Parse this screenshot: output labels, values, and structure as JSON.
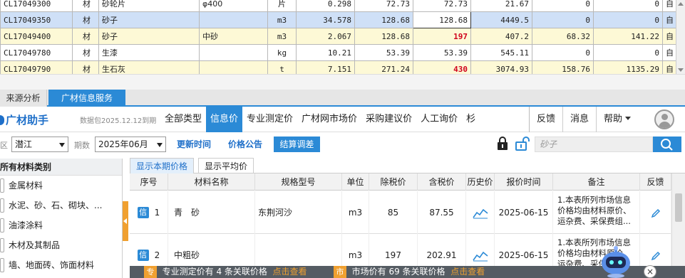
{
  "top_grid": {
    "rows": [
      {
        "code": "CL17049300",
        "type": "材",
        "name": "砂轮片",
        "spec": "φ400",
        "unit": "片",
        "qty": "0.298",
        "p1": "72.73",
        "p2": "72.73",
        "p3": "21.67",
        "p4": "0",
        "p5": "0",
        "src": "自",
        "style": "plain",
        "p2_red": false
      },
      {
        "code": "CL17049350",
        "type": "材",
        "name": "砂子",
        "spec": "",
        "unit": "m3",
        "qty": "34.578",
        "p1": "128.68",
        "p2": "128.68",
        "p3": "4449.5",
        "p4": "0",
        "p5": "0",
        "src": "自",
        "style": "selected",
        "p2_red": false
      },
      {
        "code": "CL17049400",
        "type": "材",
        "name": "砂子",
        "spec": "中砂",
        "unit": "m3",
        "qty": "2.067",
        "p1": "128.68",
        "p2": "197",
        "p3": "407.2",
        "p4": "68.32",
        "p5": "141.22",
        "src": "自",
        "style": "yellow",
        "p2_red": true
      },
      {
        "code": "CL17049780",
        "type": "材",
        "name": "生漆",
        "spec": "",
        "unit": "kg",
        "qty": "10.21",
        "p1": "53.39",
        "p2": "53.39",
        "p3": "545.11",
        "p4": "0",
        "p5": "0",
        "src": "自",
        "style": "plain",
        "p2_red": false
      },
      {
        "code": "CL17049790",
        "type": "材",
        "name": "生石灰",
        "spec": "",
        "unit": "t",
        "qty": "7.151",
        "p1": "271.24",
        "p2": "430",
        "p3": "3074.93",
        "p4": "158.76",
        "p5": "1135.29",
        "src": "自",
        "style": "yellow",
        "p2_red": true
      }
    ]
  },
  "tabs": {
    "t1": "来源分析",
    "t2": "广材信息服务"
  },
  "header": {
    "logo_text": "广材助手",
    "db_date": "数据包2025.12.12到期",
    "nav": [
      "全部类型",
      "信息价",
      "专业测定价",
      "广材网市场价",
      "采购建议价",
      "人工询价",
      "杉"
    ],
    "active_nav_index": 1,
    "right": {
      "feedback": "反馈",
      "message": "消息",
      "help": "帮助"
    }
  },
  "filter": {
    "region_label": "区",
    "region_value": "潜江",
    "period_label": "期数",
    "period_value": "2025年06月",
    "btn_update_time": "更新时间",
    "btn_price_notice": "价格公告",
    "btn_settle_adjust": "结算调差",
    "search_placeholder": "砂子"
  },
  "categories": {
    "header": "所有材料类别",
    "items": [
      "金属材料",
      "水泥、砂、石、砌块、...",
      "油漆涂料",
      "木材及其制品",
      "墙、地面砖、饰面材料"
    ]
  },
  "subtabs": {
    "current": "显示本期价格",
    "average": "显示平均价"
  },
  "price_table": {
    "columns": [
      "序号",
      "材料名称",
      "规格型号",
      "单位",
      "除税价",
      "含税价",
      "历史价",
      "报价时间",
      "备注",
      "反馈"
    ],
    "rows": [
      {
        "badge": "信",
        "no": "1",
        "name": "青　砂",
        "spec": "东荆河沙",
        "unit": "m3",
        "ex_tax": "85",
        "in_tax": "87.55",
        "date": "2025-06-15",
        "note": "1.本表所列市场信息价格均由材料原价、运杂费、采保费组..."
      },
      {
        "badge": "信",
        "no": "2",
        "name": "中粗砂",
        "spec": "",
        "unit": "m3",
        "ex_tax": "197",
        "in_tax": "202.91",
        "date": "2025-06-15",
        "note": "1.本表所列市场信息价格均由材料原价、运杂费、采保费组..."
      }
    ]
  },
  "notify": {
    "tag1": "专",
    "text1": "专业测定价有 4 条关联价格",
    "link1": "点击查看",
    "tag2": "市",
    "text2": "市场价有 69 条关联价格",
    "link2": "点击查看"
  },
  "colors": {
    "accent": "#2b8ad6",
    "warning": "#f0a030",
    "highlight_red": "#d0021b",
    "row_yellow": "#fdf9d6",
    "row_selected": "#cfe0f7"
  }
}
